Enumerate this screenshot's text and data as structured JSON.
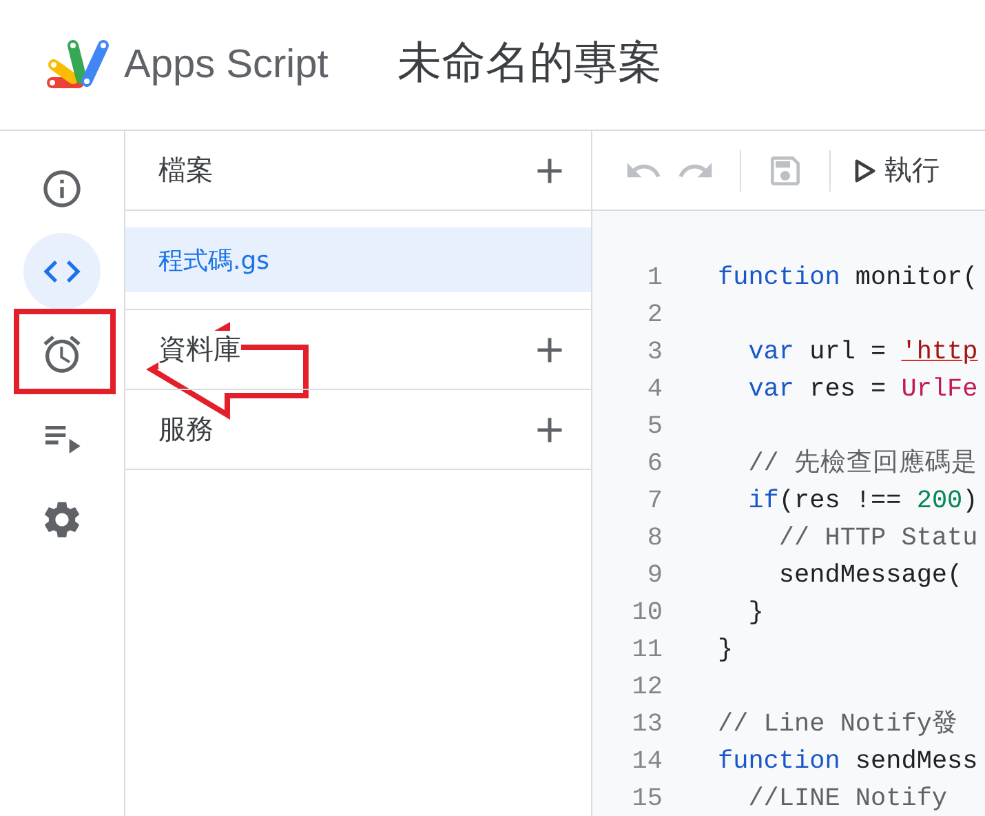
{
  "header": {
    "product": "Apps Script",
    "project_title": "未命名的專案"
  },
  "rail": [
    {
      "selected": false
    },
    {
      "selected": true
    },
    {
      "selected": false
    },
    {
      "selected": false
    },
    {
      "selected": false
    }
  ],
  "files_panel": {
    "sections": [
      {
        "title": "檔案",
        "files": [
          {
            "name": "程式碼.gs",
            "selected": true
          }
        ]
      },
      {
        "title": "資料庫"
      },
      {
        "title": "服務"
      }
    ]
  },
  "toolbar": {
    "buttons": [
      {
        "disabled": true
      },
      {
        "disabled": true
      },
      {
        "disabled": true
      }
    ],
    "run_label": "執行"
  },
  "editor": {
    "lines": [
      {
        "number": "1",
        "tokens": [
          {
            "kind": "keyword",
            "text": "function"
          },
          {
            "kind": "plain",
            "text": " monitor("
          }
        ]
      },
      {
        "number": "2"
      },
      {
        "number": "3",
        "tokens": [
          {
            "kind": "keyword",
            "text": "  var"
          },
          {
            "kind": "plain",
            "text": " url = "
          },
          {
            "kind": "string",
            "text": "'http"
          }
        ]
      },
      {
        "number": "4",
        "tokens": [
          {
            "kind": "keyword",
            "text": "  var"
          },
          {
            "kind": "plain",
            "text": " res = "
          },
          {
            "kind": "call",
            "text": "UrlFe"
          }
        ]
      },
      {
        "number": "5"
      },
      {
        "number": "6",
        "tokens": [
          {
            "kind": "comment",
            "text": "  // 先檢查回應碼是"
          }
        ]
      },
      {
        "number": "7",
        "tokens": [
          {
            "kind": "keyword",
            "text": "  if"
          },
          {
            "kind": "plain",
            "text": "(res !== "
          },
          {
            "kind": "number",
            "text": "200"
          },
          {
            "kind": "plain",
            "text": ")"
          }
        ]
      },
      {
        "number": "8",
        "tokens": [
          {
            "kind": "comment",
            "text": "    // HTTP Statu"
          }
        ]
      },
      {
        "number": "9",
        "tokens": [
          {
            "kind": "plain",
            "text": "    sendMessage("
          }
        ]
      },
      {
        "number": "10",
        "tokens": [
          {
            "kind": "plain",
            "text": "  }"
          }
        ]
      },
      {
        "number": "11",
        "tokens": [
          {
            "kind": "plain",
            "text": "}"
          }
        ]
      },
      {
        "number": "12"
      },
      {
        "number": "13",
        "tokens": [
          {
            "kind": "comment",
            "text": "// Line Notify發"
          }
        ]
      },
      {
        "number": "14",
        "tokens": [
          {
            "kind": "keyword",
            "text": "function"
          },
          {
            "kind": "plain",
            "text": " sendMess"
          }
        ]
      },
      {
        "number": "15",
        "tokens": [
          {
            "kind": "comment",
            "text": "  //LINE Notify"
          }
        ]
      }
    ]
  },
  "annotations": {
    "highlight_frame": true,
    "arrow": true
  }
}
